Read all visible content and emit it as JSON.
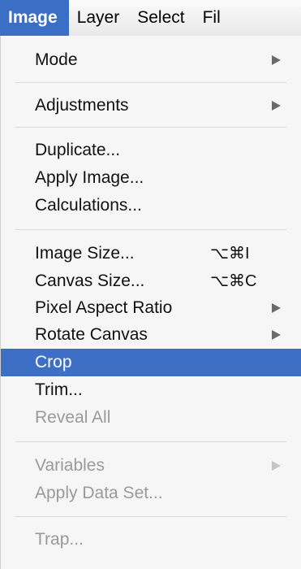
{
  "menubar": {
    "items": [
      "Image",
      "Layer",
      "Select",
      "Fil"
    ]
  },
  "menu": {
    "items": [
      {
        "label": "Mode",
        "shortcut": "",
        "submenu": true,
        "enabled": true
      },
      {
        "label": "Adjustments",
        "shortcut": "",
        "submenu": true,
        "enabled": true
      },
      {
        "label": "Duplicate...",
        "shortcut": "",
        "submenu": false,
        "enabled": true
      },
      {
        "label": "Apply Image...",
        "shortcut": "",
        "submenu": false,
        "enabled": true
      },
      {
        "label": "Calculations...",
        "shortcut": "",
        "submenu": false,
        "enabled": true
      },
      {
        "label": "Image Size...",
        "shortcut": "⌥⌘I",
        "submenu": false,
        "enabled": true
      },
      {
        "label": "Canvas Size...",
        "shortcut": "⌥⌘C",
        "submenu": false,
        "enabled": true
      },
      {
        "label": "Pixel Aspect Ratio",
        "shortcut": "",
        "submenu": true,
        "enabled": true
      },
      {
        "label": "Rotate Canvas",
        "shortcut": "",
        "submenu": true,
        "enabled": true
      },
      {
        "label": "Crop",
        "shortcut": "",
        "submenu": false,
        "enabled": true,
        "highlighted": true
      },
      {
        "label": "Trim...",
        "shortcut": "",
        "submenu": false,
        "enabled": true
      },
      {
        "label": "Reveal All",
        "shortcut": "",
        "submenu": false,
        "enabled": false
      },
      {
        "label": "Variables",
        "shortcut": "",
        "submenu": true,
        "enabled": false
      },
      {
        "label": "Apply Data Set...",
        "shortcut": "",
        "submenu": false,
        "enabled": false
      },
      {
        "label": "Trap...",
        "shortcut": "",
        "submenu": false,
        "enabled": false
      }
    ]
  },
  "colors": {
    "highlight": "#3d6fc7",
    "disabled_text": "#9a9a9a"
  }
}
